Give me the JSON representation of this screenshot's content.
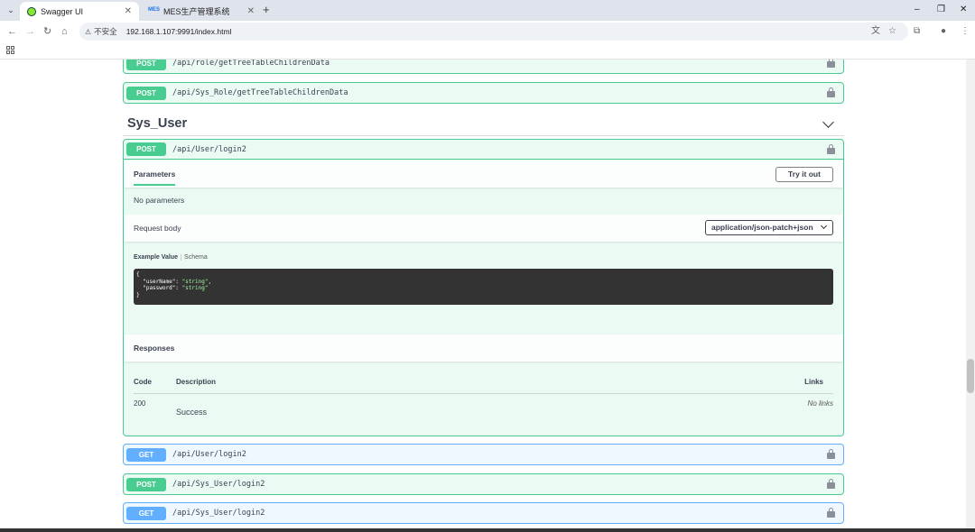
{
  "browser": {
    "tabs": [
      {
        "title": "Swagger UI",
        "active": true
      },
      {
        "title": "MES生产管理系统",
        "active": false
      }
    ],
    "favicon_mes": "MES",
    "address": {
      "security_label": "不安全",
      "url": "192.168.1.107:9991/index.html"
    }
  },
  "page": {
    "top_blocks": [
      {
        "method": "POST",
        "path": "/api/role/getTreeTableChildrenData"
      },
      {
        "method": "POST",
        "path": "/api/Sys_Role/getTreeTableChildrenData"
      }
    ],
    "tag": {
      "title": "Sys_User"
    },
    "expanded": {
      "method": "POST",
      "path": "/api/User/login2",
      "parameters_tab": "Parameters",
      "try_button": "Try it out",
      "no_params": "No parameters",
      "request_body_label": "Request body",
      "content_type": "application/json-patch+json",
      "example_value_tab": "Example Value",
      "schema_tab": "Schema",
      "code": {
        "open": "{",
        "line1_key": "  \"userName\": ",
        "line1_val": "\"string\"",
        "line1_end": ",",
        "line2_key": "  \"password\": ",
        "line2_val": "\"string\"",
        "close": "}"
      },
      "responses_title": "Responses",
      "table_headers": {
        "code": "Code",
        "description": "Description",
        "links": "Links"
      },
      "response": {
        "code": "200",
        "description": "Success",
        "links": "No links"
      }
    },
    "bottom_blocks": [
      {
        "method": "GET",
        "path": "/api/User/login2"
      },
      {
        "method": "POST",
        "path": "/api/Sys_User/login2"
      },
      {
        "method": "GET",
        "path": "/api/Sys_User/login2"
      }
    ]
  },
  "colors": {
    "post": "#49cc90",
    "get": "#61affe",
    "code_bg": "#333333"
  }
}
